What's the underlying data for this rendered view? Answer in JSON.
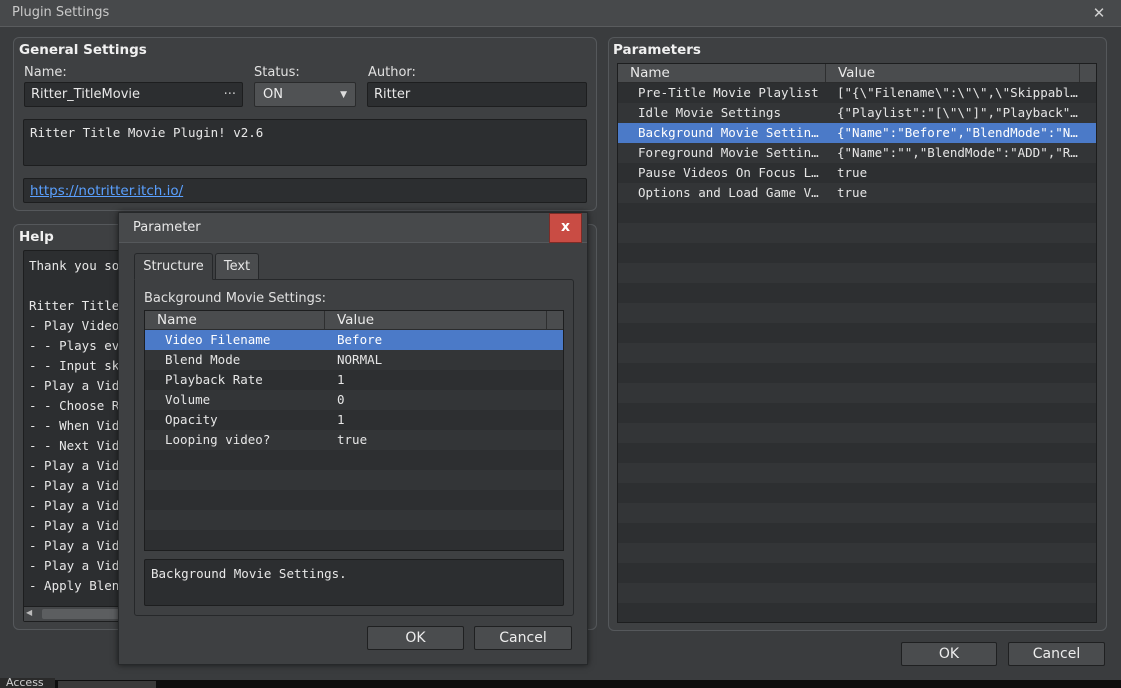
{
  "window": {
    "title": "Plugin Settings",
    "close_glyph": "✕"
  },
  "general": {
    "title": "General Settings",
    "name_label": "Name:",
    "name_value": "Ritter_TitleMovie",
    "name_btn": "···",
    "status_label": "Status:",
    "status_value": "ON",
    "status_arrow": "▼",
    "author_label": "Author:",
    "author_value": "Ritter",
    "description": "Ritter Title Movie Plugin! v2.6",
    "link": "https://notritter.itch.io/"
  },
  "help": {
    "title": "Help",
    "lines": [
      "Thank you so",
      "",
      "Ritter Title",
      "- Play Videos",
      "- - Plays eve",
      "- - Input ski",
      "- Play a Vide",
      "- - Choose Ra",
      "- - When Vide",
      "- - Next Vide",
      "- Play a Vide",
      "- Play a Vide",
      "- Play a Vide",
      "- Play a Vide",
      "- Play a Vide",
      "- Play a Vide",
      "- Apply Blend"
    ],
    "scroll_left": "◀"
  },
  "parameters": {
    "title": "Parameters",
    "columns": [
      "Name",
      "Value"
    ],
    "rows": [
      {
        "name": "Pre-Title Movie Playlist",
        "value": "[\"{\\\"Filename\\\":\\\"\\\",\\\"Skippable\\\"…"
      },
      {
        "name": "Idle Movie Settings",
        "value": "{\"Playlist\":\"[\\\"\\\"]\",\"Playback\":…"
      },
      {
        "name": "Background Movie Settings",
        "value": "{\"Name\":\"Before\",\"BlendMode\":\"NO…"
      },
      {
        "name": "Foreground Movie Settings",
        "value": "{\"Name\":\"\",\"BlendMode\":\"ADD\",\"Ra…"
      },
      {
        "name": "Pause Videos On Focus Lost",
        "value": "true"
      },
      {
        "name": "Options and Load Game Vi…",
        "value": "true"
      }
    ]
  },
  "main_buttons": {
    "ok": "OK",
    "cancel": "Cancel"
  },
  "dialog": {
    "title": "Parameter",
    "close_glyph": "x",
    "tabs": [
      "Structure",
      "Text"
    ],
    "section_label": "Background Movie Settings:",
    "columns": [
      "Name",
      "Value"
    ],
    "rows": [
      {
        "name": "Video Filename",
        "value": "Before"
      },
      {
        "name": "Blend Mode",
        "value": "NORMAL"
      },
      {
        "name": "Playback Rate",
        "value": "1"
      },
      {
        "name": "Volume",
        "value": "0"
      },
      {
        "name": "Opacity",
        "value": "1"
      },
      {
        "name": "Looping video?",
        "value": "true"
      }
    ],
    "description": "Background Movie Settings.",
    "ok": "OK",
    "cancel": "Cancel"
  },
  "taskbar": {
    "label": "Access"
  },
  "colors": {
    "selection": "#4b7ac8",
    "close_red": "#c94c44",
    "link": "#5aa0ff"
  }
}
